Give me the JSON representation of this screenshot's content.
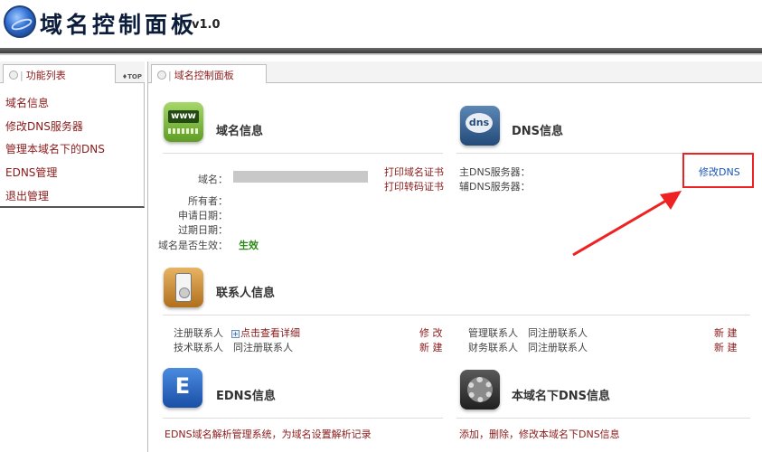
{
  "header": {
    "title": "域名控制面板",
    "version": "v1.0"
  },
  "sidebar": {
    "tab_label": "功能列表",
    "top_label": "♦TOP",
    "items": [
      {
        "label": "域名信息"
      },
      {
        "label": "修改DNS服务器"
      },
      {
        "label": "管理本域名下的DNS"
      },
      {
        "label": "EDNS管理"
      },
      {
        "label": "退出管理"
      }
    ]
  },
  "main": {
    "tab_label": "域名控制面板",
    "domain_info": {
      "title": "域名信息",
      "icon_text": "www",
      "fields": {
        "domain": "域名：",
        "owner": "所有者：",
        "apply_date": "申请日期：",
        "expire_date": "过期日期：",
        "effective": "域名是否生效："
      },
      "effective_value": "生效",
      "print_cert": "打印域名证书",
      "print_transfer": "打印转码证书"
    },
    "dns_info": {
      "title": "DNS信息",
      "icon_text": "dns",
      "primary": "主DNS服务器：",
      "secondary": "辅DNS服务器：",
      "modify_link": "修改DNS"
    },
    "contact_info": {
      "title": "联系人信息",
      "registrant_label": "注册联系人",
      "registrant_value": "点击查看详细",
      "registrant_action": "修 改",
      "tech_label": "技术联系人",
      "tech_value": "同注册联系人",
      "tech_action": "新 建",
      "admin_label": "管理联系人",
      "admin_value": "同注册联系人",
      "admin_action": "新 建",
      "finance_label": "财务联系人",
      "finance_value": "同注册联系人",
      "finance_action": "新 建"
    },
    "edns_info": {
      "title": "EDNS信息",
      "icon_text": "E",
      "description": "EDNS域名解析管理系统，为域名设置解析记录"
    },
    "local_dns_info": {
      "title": "本域名下DNS信息",
      "description": "添加，删除，修改本域名下DNS信息"
    }
  },
  "colors": {
    "link_red": "#8b1a1a",
    "link_blue": "#1a55b5",
    "effective_green": "#2c8a18",
    "highlight_red": "#ee2222"
  }
}
